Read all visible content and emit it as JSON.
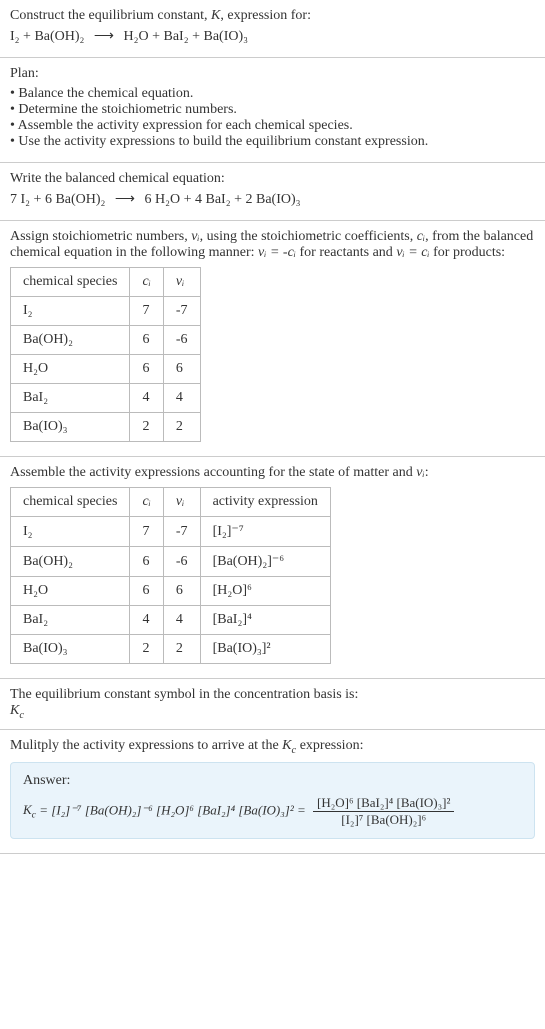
{
  "header": {
    "prompt1": "Construct the equilibrium constant, ",
    "prompt_K": "K",
    "prompt2": ", expression for:",
    "eq_lhs": "I₂ + Ba(OH)₂",
    "eq_arrow": "⟶",
    "eq_rhs": "H₂O + BaI₂ + Ba(IO)₃"
  },
  "plan": {
    "title": "Plan:",
    "items": [
      "Balance the chemical equation.",
      "Determine the stoichiometric numbers.",
      "Assemble the activity expression for each chemical species.",
      "Use the activity expressions to build the equilibrium constant expression."
    ]
  },
  "balanced": {
    "intro": "Write the balanced chemical equation:",
    "lhs": "7 I₂ + 6 Ba(OH)₂",
    "arrow": "⟶",
    "rhs": "6 H₂O + 4 BaI₂ + 2 Ba(IO)₃"
  },
  "stoich": {
    "intro1": "Assign stoichiometric numbers, ",
    "nu": "ν",
    "nui": "νᵢ",
    "intro2": ", using the stoichiometric coefficients, ",
    "ci": "cᵢ",
    "intro3": ", from the balanced chemical equation in the following manner: ",
    "rel1": "νᵢ = -cᵢ",
    "intro4": " for reactants and ",
    "rel2": "νᵢ = cᵢ",
    "intro5": " for products:",
    "headers": [
      "chemical species",
      "cᵢ",
      "νᵢ"
    ],
    "rows": [
      {
        "species": "I₂",
        "c": "7",
        "nu": "-7"
      },
      {
        "species": "Ba(OH)₂",
        "c": "6",
        "nu": "-6"
      },
      {
        "species": "H₂O",
        "c": "6",
        "nu": "6"
      },
      {
        "species": "BaI₂",
        "c": "4",
        "nu": "4"
      },
      {
        "species": "Ba(IO)₃",
        "c": "2",
        "nu": "2"
      }
    ]
  },
  "activity": {
    "intro": "Assemble the activity expressions accounting for the state of matter and ",
    "nui": "νᵢ",
    "colon": ":",
    "headers": [
      "chemical species",
      "cᵢ",
      "νᵢ",
      "activity expression"
    ],
    "rows": [
      {
        "species": "I₂",
        "c": "7",
        "nu": "-7",
        "expr": "[I₂]⁻⁷"
      },
      {
        "species": "Ba(OH)₂",
        "c": "6",
        "nu": "-6",
        "expr": "[Ba(OH)₂]⁻⁶"
      },
      {
        "species": "H₂O",
        "c": "6",
        "nu": "6",
        "expr": "[H₂O]⁶"
      },
      {
        "species": "BaI₂",
        "c": "4",
        "nu": "4",
        "expr": "[BaI₂]⁴"
      },
      {
        "species": "Ba(IO)₃",
        "c": "2",
        "nu": "2",
        "expr": "[Ba(IO)₃]²"
      }
    ]
  },
  "kc_symbol": {
    "line1": "The equilibrium constant symbol in the concentration basis is:",
    "symbol": "K_c"
  },
  "multiply": {
    "intro1": "Mulitply the activity expressions to arrive at the ",
    "kc": "K_c",
    "intro2": " expression:"
  },
  "answer": {
    "label": "Answer:",
    "lhs": "K_c = [I₂]⁻⁷ [Ba(OH)₂]⁻⁶ [H₂O]⁶ [BaI₂]⁴ [Ba(IO)₃]² =",
    "frac_num": "[H₂O]⁶ [BaI₂]⁴ [Ba(IO)₃]²",
    "frac_den": "[I₂]⁷ [Ba(OH)₂]⁶"
  }
}
